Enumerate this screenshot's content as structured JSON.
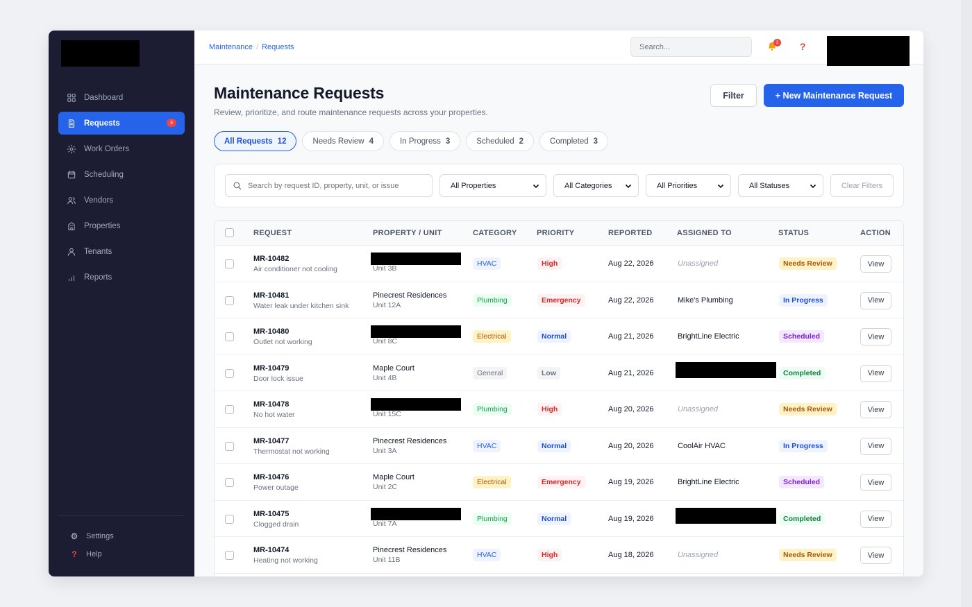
{
  "sidebar": {
    "items": [
      {
        "label": "Dashboard",
        "icon": "grid-icon",
        "active": false
      },
      {
        "label": "Requests",
        "icon": "document-icon",
        "active": true,
        "badge": "3"
      },
      {
        "label": "Work Orders",
        "icon": "gear-icon",
        "active": false
      },
      {
        "label": "Scheduling",
        "icon": "calendar-icon",
        "active": false
      },
      {
        "label": "Vendors",
        "icon": "users-icon",
        "active": false
      },
      {
        "label": "Properties",
        "icon": "building-icon",
        "active": false
      },
      {
        "label": "Tenants",
        "icon": "user-icon",
        "active": false
      },
      {
        "label": "Reports",
        "icon": "bar-chart-icon",
        "active": false
      }
    ],
    "bottom": [
      {
        "label": "Settings",
        "icon": "gear-icon",
        "glyph": "⚙"
      },
      {
        "label": "Help",
        "icon": "question-icon",
        "glyph": "?"
      }
    ]
  },
  "topbar": {
    "breadcrumb": [
      "Maintenance",
      "Requests"
    ],
    "search_placeholder": "Search...",
    "notification_count": "3"
  },
  "page": {
    "title": "Maintenance Requests",
    "subtitle": "Review, prioritize, and route maintenance requests across your properties.",
    "filter_label": "Filter",
    "new_label": "+ New Maintenance Request"
  },
  "tabs": [
    {
      "label": "All Requests",
      "count": "12",
      "active": true
    },
    {
      "label": "Needs Review",
      "count": "4",
      "active": false
    },
    {
      "label": "In Progress",
      "count": "3",
      "active": false
    },
    {
      "label": "Scheduled",
      "count": "2",
      "active": false
    },
    {
      "label": "Completed",
      "count": "3",
      "active": false
    }
  ],
  "filters": {
    "search_placeholder": "Search by request ID, property, unit, or issue",
    "properties": "All Properties",
    "categories": "All Categories",
    "priorities": "All Priorities",
    "statuses": "All Statuses",
    "clear_label": "Clear Filters"
  },
  "table": {
    "columns": [
      "REQUEST",
      "PROPERTY / UNIT",
      "CATEGORY",
      "PRIORITY",
      "REPORTED",
      "ASSIGNED TO",
      "STATUS",
      "ACTION"
    ],
    "rows": [
      {
        "id": "MR-10482",
        "desc": "Air conditioner not cooling",
        "property": "",
        "unit": "Unit 3B",
        "property_redacted": true,
        "category": "HVAC",
        "priority": "High",
        "reported": "Aug 22, 2026",
        "assigned": "Unassigned",
        "assigned_redacted": false,
        "status": "Needs Review",
        "action": "View"
      },
      {
        "id": "MR-10481",
        "desc": "Water leak under kitchen sink",
        "property": "Pinecrest Residences",
        "unit": "Unit 12A",
        "property_redacted": false,
        "category": "Plumbing",
        "priority": "Emergency",
        "reported": "Aug 22, 2026",
        "assigned": "Mike's Plumbing",
        "assigned_redacted": false,
        "status": "In Progress",
        "action": "View"
      },
      {
        "id": "MR-10480",
        "desc": "Outlet not working",
        "property": "",
        "unit": "Unit 8C",
        "property_redacted": true,
        "category": "Electrical",
        "priority": "Normal",
        "reported": "Aug 21, 2026",
        "assigned": "BrightLine Electric",
        "assigned_redacted": false,
        "status": "Scheduled",
        "action": "View"
      },
      {
        "id": "MR-10479",
        "desc": "Door lock issue",
        "property": "Maple Court",
        "unit": "Unit 4B",
        "property_redacted": false,
        "category": "General",
        "priority": "Low",
        "reported": "Aug 21, 2026",
        "assigned": "",
        "assigned_redacted": true,
        "status": "Completed",
        "action": "View"
      },
      {
        "id": "MR-10478",
        "desc": "No hot water",
        "property": "",
        "unit": "Unit 15C",
        "property_redacted": true,
        "category": "Plumbing",
        "priority": "High",
        "reported": "Aug 20, 2026",
        "assigned": "Unassigned",
        "assigned_redacted": false,
        "status": "Needs Review",
        "action": "View"
      },
      {
        "id": "MR-10477",
        "desc": "Thermostat not working",
        "property": "Pinecrest Residences",
        "unit": "Unit 3A",
        "property_redacted": false,
        "category": "HVAC",
        "priority": "Normal",
        "reported": "Aug 20, 2026",
        "assigned": "CoolAir HVAC",
        "assigned_redacted": false,
        "status": "In Progress",
        "action": "View"
      },
      {
        "id": "MR-10476",
        "desc": "Power outage",
        "property": "Maple Court",
        "unit": "Unit 2C",
        "property_redacted": false,
        "category": "Electrical",
        "priority": "Emergency",
        "reported": "Aug 19, 2026",
        "assigned": "BrightLine Electric",
        "assigned_redacted": false,
        "status": "Scheduled",
        "action": "View"
      },
      {
        "id": "MR-10475",
        "desc": "Clogged drain",
        "property": "",
        "unit": "Unit 7A",
        "property_redacted": true,
        "category": "Plumbing",
        "priority": "Normal",
        "reported": "Aug 19, 2026",
        "assigned": "",
        "assigned_redacted": true,
        "status": "Completed",
        "action": "View"
      },
      {
        "id": "MR-10474",
        "desc": "Heating not working",
        "property": "Pinecrest Residences",
        "unit": "Unit 11B",
        "property_redacted": false,
        "category": "HVAC",
        "priority": "High",
        "reported": "Aug 18, 2026",
        "assigned": "Unassigned",
        "assigned_redacted": false,
        "status": "Needs Review",
        "action": "View"
      }
    ]
  },
  "colors": {
    "sidebar_bg": "#1c1d33",
    "accent": "#2563eb",
    "danger": "#ef4444"
  }
}
